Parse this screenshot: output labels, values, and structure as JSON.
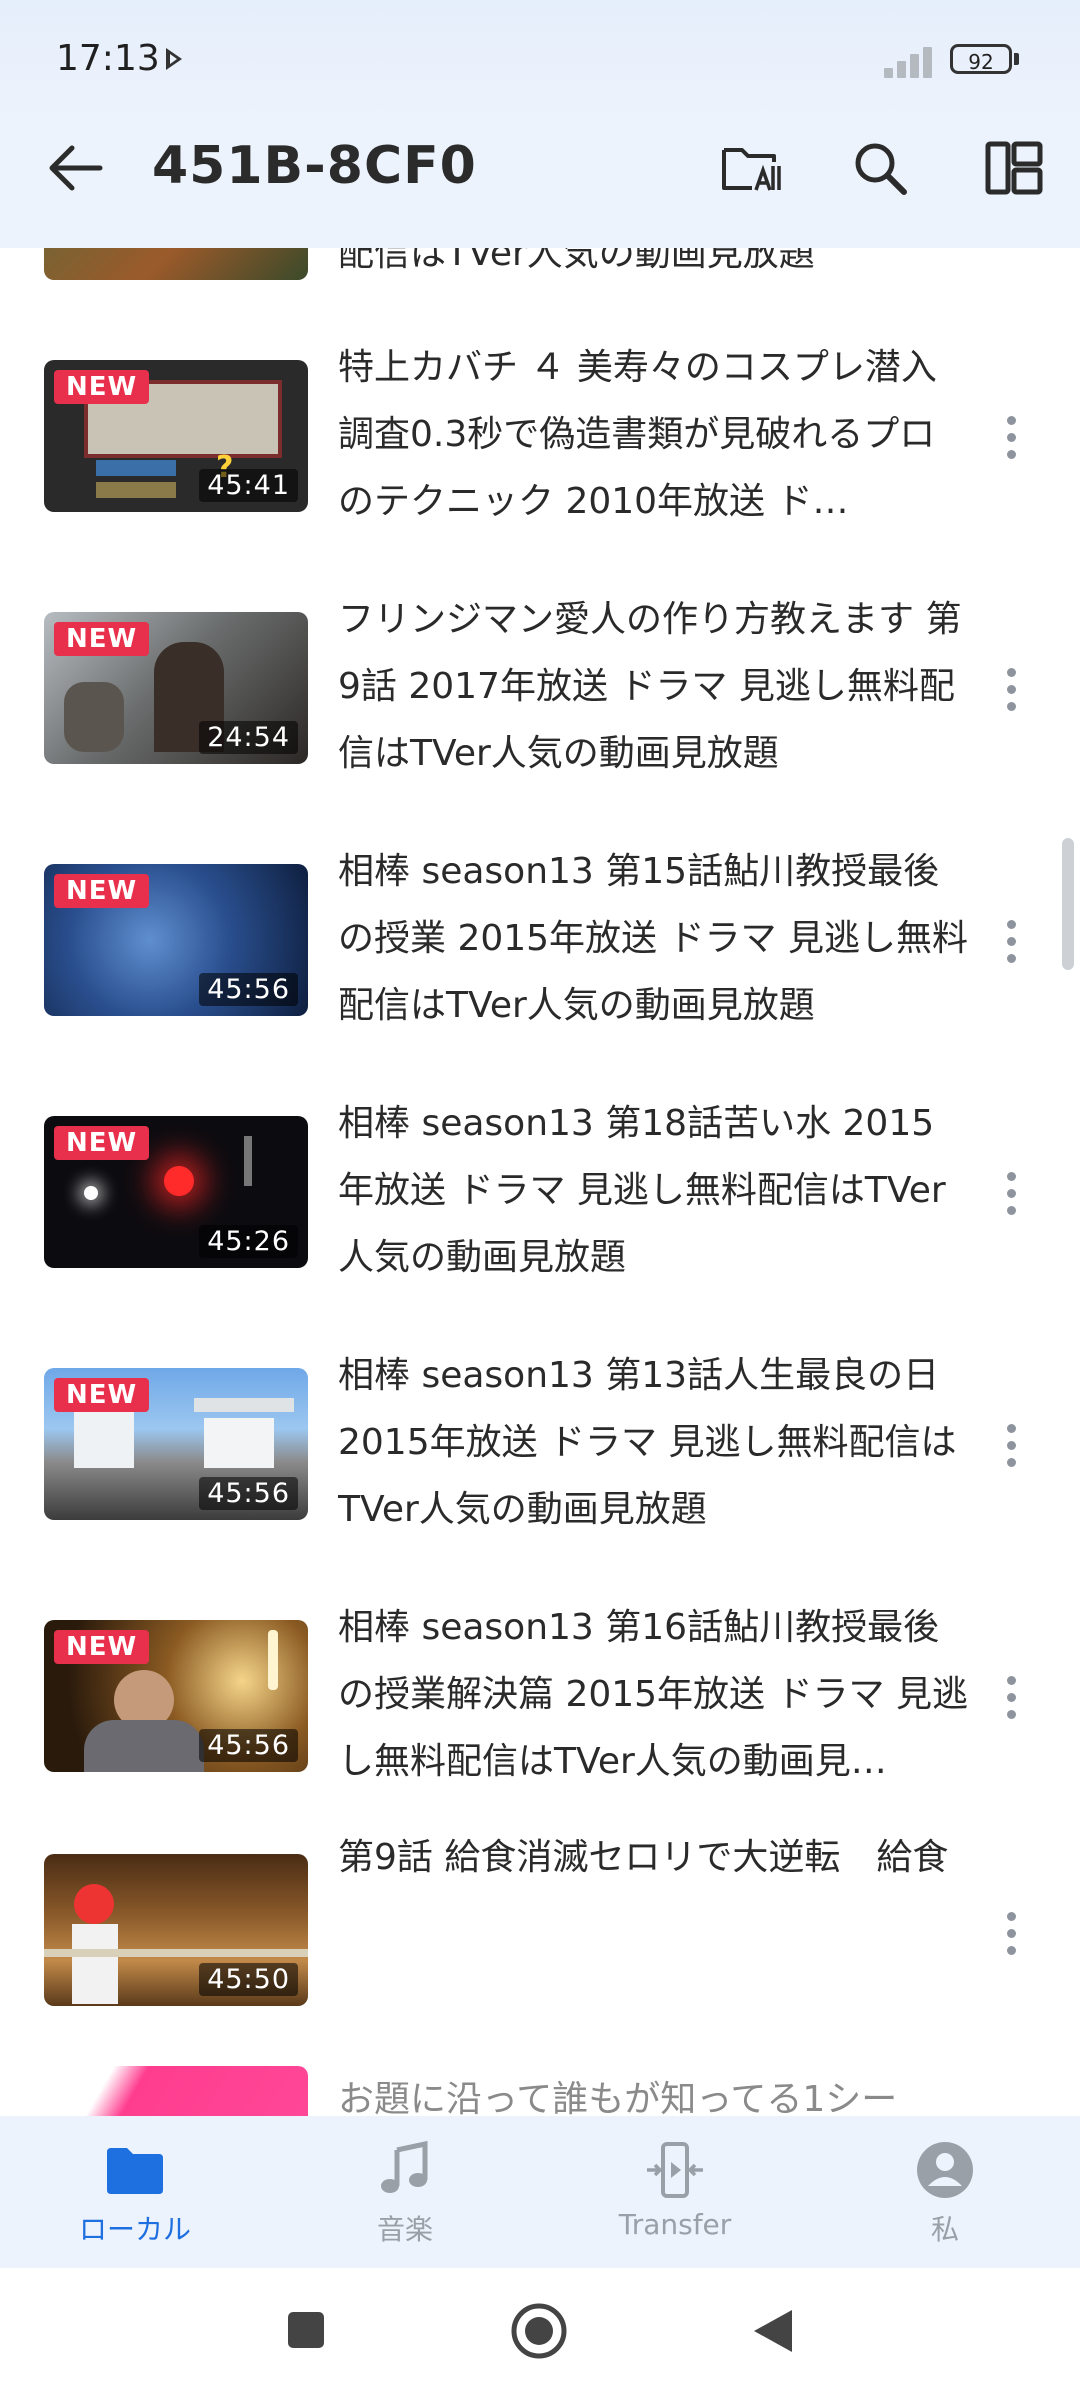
{
  "status_bar": {
    "time": "17:13",
    "battery": "92"
  },
  "app_bar": {
    "title": "451B-8CF0"
  },
  "partial_top_text": "配信はTVer人気の動画見放題",
  "videos": [
    {
      "title": "特上カバチ ４ 美寿々のコスプレ潜入調査0.3秒で偽造書類が見破れるプロのテクニック 2010年放送 ド…",
      "badge": "NEW",
      "duration": "45:41"
    },
    {
      "title": "フリンジマン愛人の作り方教えます 第9話 2017年放送 ドラマ 見逃し無料配信はTVer人気の動画見放題",
      "badge": "NEW",
      "duration": "24:54"
    },
    {
      "title": "相棒 season13 第15話鮎川教授最後の授業 2015年放送 ドラマ 見逃し無料配信はTVer人気の動画見放題",
      "badge": "NEW",
      "duration": "45:56"
    },
    {
      "title": "相棒 season13 第18話苦い水 2015年放送 ドラマ 見逃し無料配信はTVer人気の動画見放題",
      "badge": "NEW",
      "duration": "45:26"
    },
    {
      "title": "相棒 season13 第13話人生最良の日 2015年放送 ドラマ 見逃し無料配信はTVer人気の動画見放題",
      "badge": "NEW",
      "duration": "45:56"
    },
    {
      "title": "相棒 season13 第16話鮎川教授最後の授業解決篇 2015年放送 ドラマ 見逃し無料配信はTVer人気の動画見…",
      "badge": "NEW",
      "duration": "45:56"
    },
    {
      "title": "第9話 給食消滅セロリで大逆転　給食",
      "duration": "45:50"
    }
  ],
  "partial_bottom_text": "お題に沿って誰もが知ってる1シー",
  "bottom_nav": [
    {
      "label": "ローカル",
      "icon": "folder-icon"
    },
    {
      "label": "音楽",
      "icon": "music-note-icon"
    },
    {
      "label": "Transfer",
      "icon": "transfer-icon"
    },
    {
      "label": "私",
      "icon": "profile-icon"
    }
  ],
  "colors": {
    "accent": "#1e6fe0",
    "badge": "#e8304c",
    "header_bg": "#edf3fc"
  }
}
